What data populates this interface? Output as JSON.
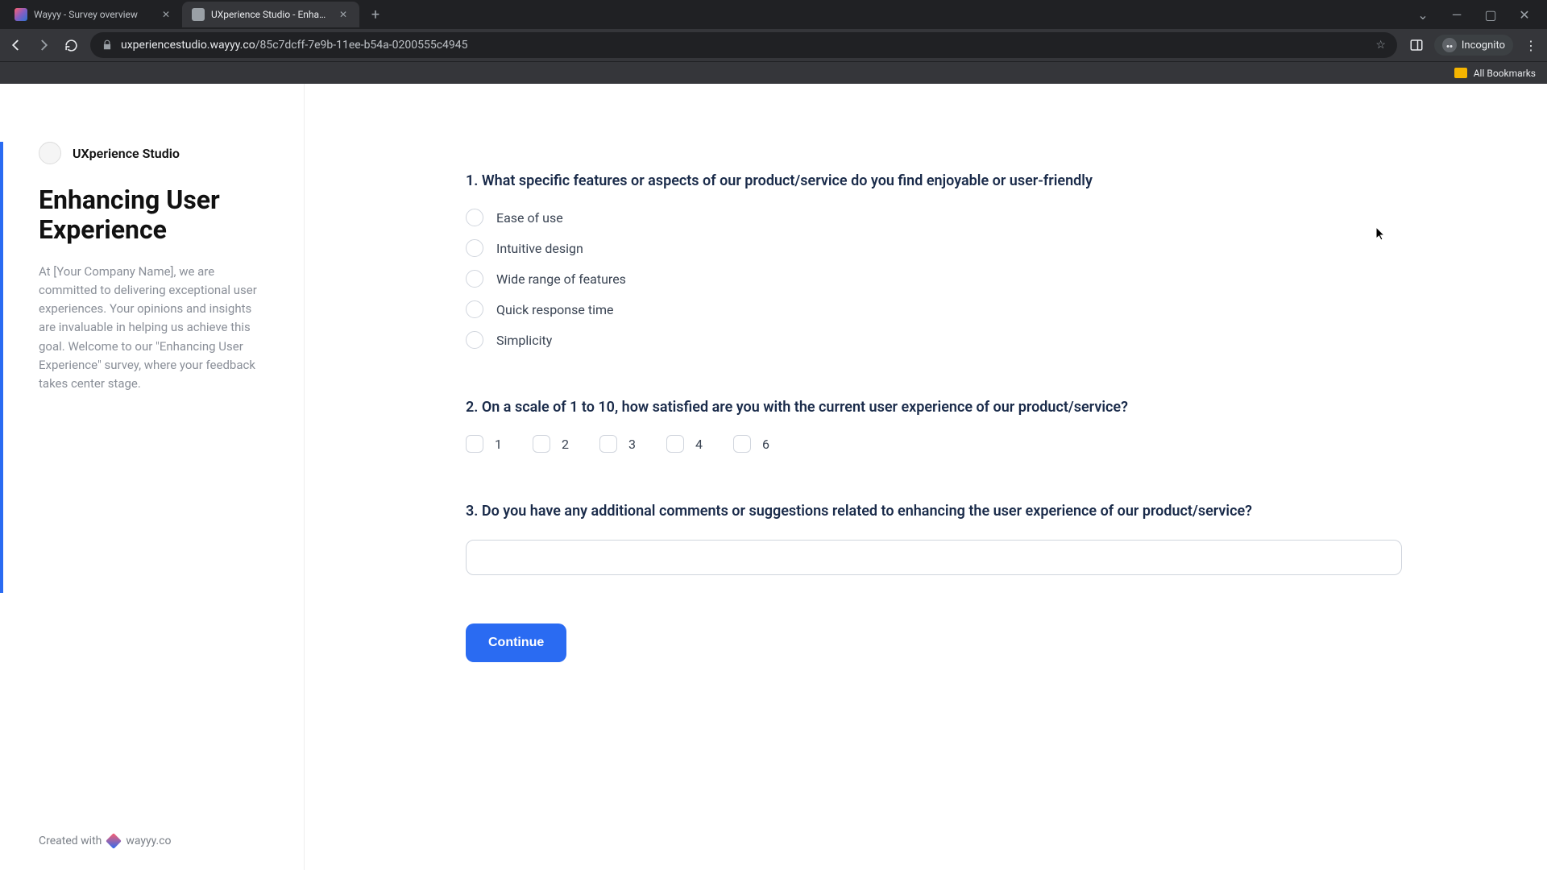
{
  "browser": {
    "tabs": [
      {
        "title": "Wayyy - Survey overview",
        "active": false
      },
      {
        "title": "UXperience Studio - Enhancing",
        "active": true
      }
    ],
    "url_host": "uxperiencestudio.wayyy.co",
    "url_path": "/85c7dcff-7e9b-11ee-b54a-0200555c4945",
    "incognito_label": "Incognito",
    "all_bookmarks": "All Bookmarks"
  },
  "sidebar": {
    "org_name": "UXperience Studio",
    "title": "Enhancing User Experience",
    "description": "At [Your Company Name], we are committed to delivering exceptional user experiences. Your opinions and insights are invaluable in helping us achieve this goal. Welcome to our \"Enhancing User Experience\" survey, where your feedback takes center stage.",
    "created_prefix": "Created with",
    "created_brand": "wayyy.co"
  },
  "questions": {
    "q1": {
      "title": "1. What specific features or aspects of our product/service do you find enjoyable or user-friendly",
      "options": [
        "Ease of use",
        "Intuitive design",
        "Wide range of features",
        "Quick response time",
        "Simplicity"
      ]
    },
    "q2": {
      "title": "2. On a scale of 1 to 10, how satisfied are you with the current user experience of our product/service?",
      "options": [
        "1",
        "2",
        "3",
        "4",
        "6"
      ]
    },
    "q3": {
      "title": "3. Do you have any additional comments or suggestions related to enhancing the user experience of our product/service?"
    }
  },
  "continue_label": "Continue"
}
